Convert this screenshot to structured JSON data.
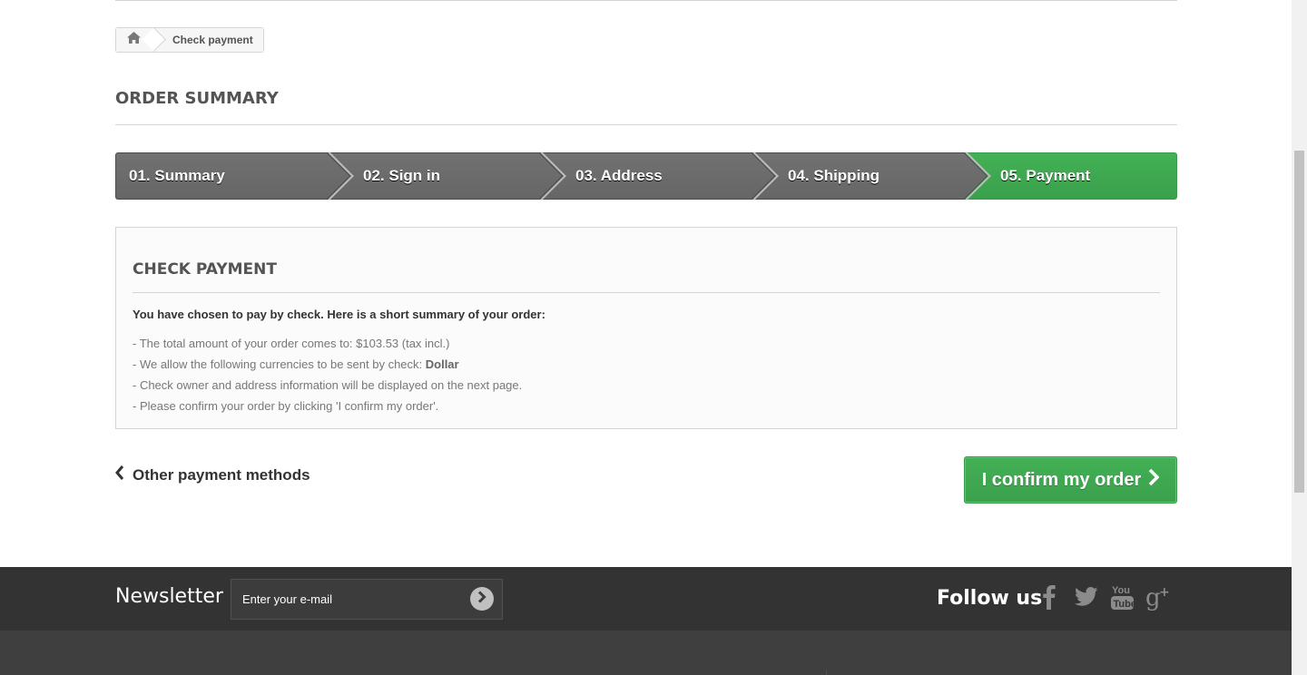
{
  "breadcrumb": {
    "home_icon": "home-icon",
    "current": "Check payment"
  },
  "page_heading": "ORDER SUMMARY",
  "steps": [
    {
      "label": "01. Summary",
      "active": false
    },
    {
      "label": "02. Sign in",
      "active": false
    },
    {
      "label": "03. Address",
      "active": false
    },
    {
      "label": "04. Shipping",
      "active": false
    },
    {
      "label": "05. Payment",
      "active": true
    }
  ],
  "payment_box": {
    "title": "CHECK PAYMENT",
    "intro": "You have chosen to pay by check. Here is a short summary of your order:",
    "line1_prefix": "- The total amount of your order comes to: $103.53 (tax incl.)",
    "line2_prefix": "- We allow the following currencies to be sent by check: ",
    "line2_currency": "Dollar",
    "line3": "- Check owner and address information will be displayed on the next page.",
    "line4": "- Please confirm your order by clicking 'I confirm my order'."
  },
  "actions": {
    "back_label": "Other payment methods",
    "confirm_label": "I confirm my order"
  },
  "footer": {
    "newsletter_title": "Newsletter",
    "newsletter_placeholder": "Enter your e-mail",
    "follow_title": "Follow us",
    "social_icons": [
      "facebook-icon",
      "twitter-icon",
      "youtube-icon",
      "google-plus-icon"
    ]
  },
  "colors": {
    "accent_green": "#3aa04c",
    "step_gray": "#666666",
    "footer_bg": "#333333"
  }
}
